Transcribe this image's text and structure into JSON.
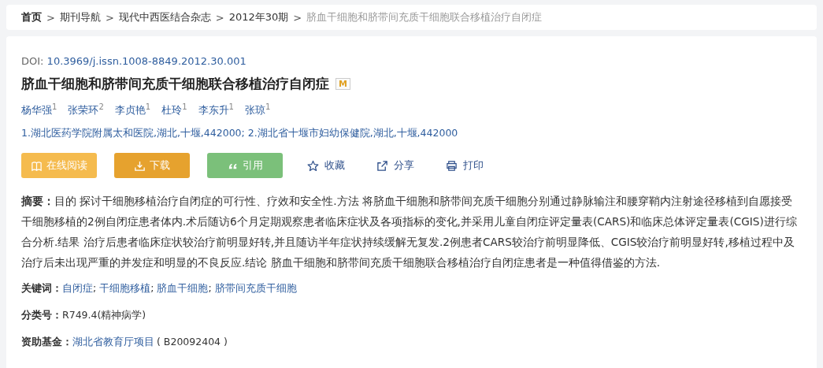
{
  "breadcrumb": [
    {
      "label": "首页",
      "kind": "home"
    },
    {
      "label": "期刊导航",
      "kind": "link"
    },
    {
      "label": "现代中西医结合杂志",
      "kind": "link"
    },
    {
      "label": "2012年30期",
      "kind": "link"
    },
    {
      "label": "脐血干细胞和脐带间充质干细胞联合移植治疗自闭症",
      "kind": "current"
    }
  ],
  "separator": ">",
  "article": {
    "doi_label": "DOI:",
    "doi": "10.3969/j.issn.1008-8849.2012.30.001",
    "title": "脐血干细胞和脐带间充质干细胞联合移植治疗自闭症",
    "badge": "M",
    "authors": [
      {
        "name": "杨华强",
        "sup": "1"
      },
      {
        "name": "张荣环",
        "sup": "2"
      },
      {
        "name": "李贞艳",
        "sup": "1"
      },
      {
        "name": "杜玲",
        "sup": "1"
      },
      {
        "name": "李东升",
        "sup": "1"
      },
      {
        "name": "张琼",
        "sup": "1"
      }
    ],
    "affiliations": "1.湖北医药学院附属太和医院,湖北,十堰,442000; 2.湖北省十堰市妇幼保健院,湖北,十堰,442000",
    "actions": [
      {
        "label": "在线阅读",
        "kind": "filled",
        "color": "#f5bb4e"
      },
      {
        "label": "下载",
        "kind": "filled",
        "color": "#e6a22e"
      },
      {
        "label": "引用",
        "kind": "filled",
        "color": "#7bc07a"
      },
      {
        "label": "收藏",
        "kind": "plain"
      },
      {
        "label": "分享",
        "kind": "plain"
      },
      {
        "label": "打印",
        "kind": "plain"
      }
    ],
    "abstract_label": "摘要：",
    "abstract": "目的 探讨干细胞移植治疗自闭症的可行性、疗效和安全性.方法 将脐血干细胞和脐带间充质干细胞分别通过静脉输注和腰穿鞘内注射途径移植到自愿接受干细胞移植的2例自闭症患者体内.术后随访6个月定期观察患者临床症状及各项指标的变化,并采用儿童自闭症评定量表(CARS)和临床总体评定量表(CGIS)进行综合分析.结果 治疗后患者临床症状较治疗前明显好转,并且随访半年症状持续缓解无复发.2例患者CARS较治疗前明显降低、CGIS较治疗前明显好转,移植过程中及治疗后未出现严重的并发症和明显的不良反应.结论 脐血干细胞和脐带间充质干细胞联合移植治疗自闭症患者是一种值得借鉴的方法.",
    "keywords_label": "关键词：",
    "keywords": [
      "自闭症",
      "干细胞移植",
      "脐血干细胞",
      "脐带间充质干细胞"
    ],
    "keyword_separator": ";",
    "class_label": "分类号：",
    "class": "R749.4(精神病学)",
    "fund_label": "资助基金：",
    "fund": "湖北省教育厅项目",
    "fund_code": "( B20092404 )"
  }
}
